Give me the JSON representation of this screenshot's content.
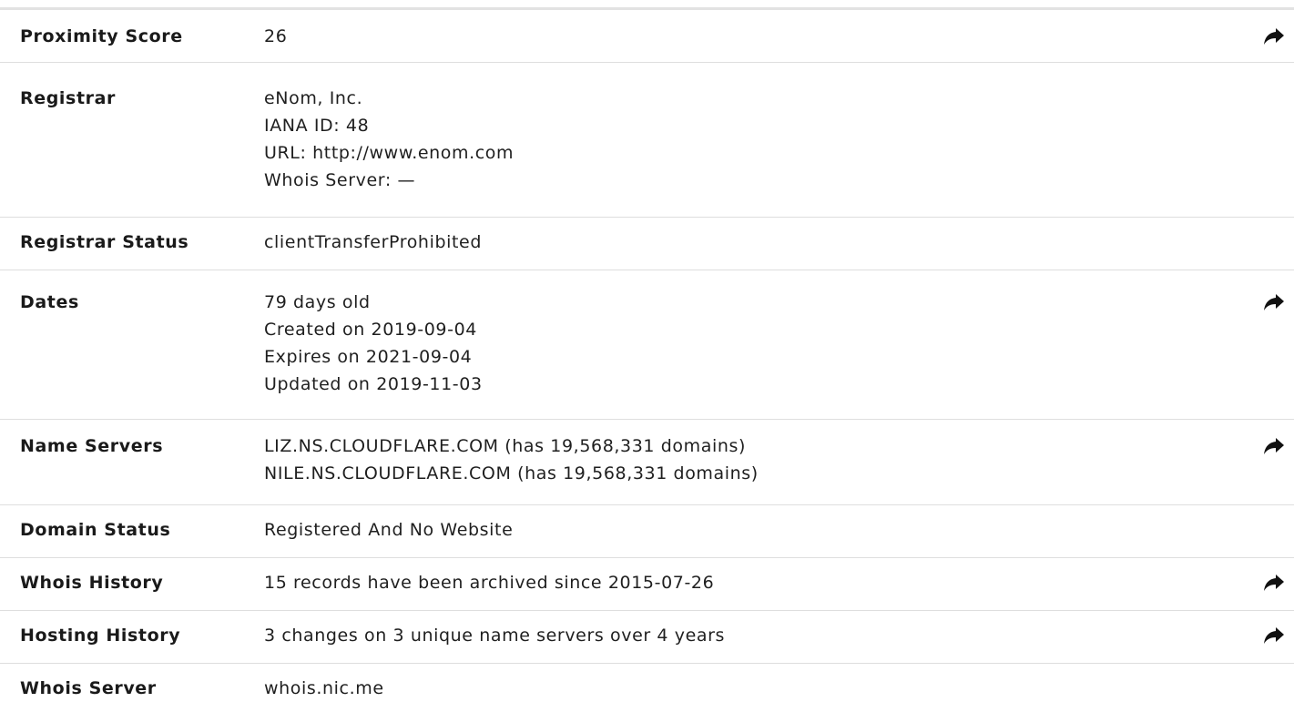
{
  "rows": [
    {
      "label": "Proximity Score",
      "lines": [
        "26"
      ],
      "share": true
    },
    {
      "label": "Registrar",
      "lines": [
        "eNom, Inc.",
        "IANA ID: 48",
        "URL: http://www.enom.com",
        "Whois Server: —"
      ],
      "share": false
    },
    {
      "label": "Registrar Status",
      "lines": [
        "clientTransferProhibited"
      ],
      "share": false
    },
    {
      "label": "Dates",
      "lines": [
        "79 days old",
        "Created on 2019-09-04",
        "Expires on 2021-09-04",
        "Updated on 2019-11-03"
      ],
      "share": true
    },
    {
      "label": "Name Servers",
      "lines": [
        "LIZ.NS.CLOUDFLARE.COM (has 19,568,331 domains)",
        "NILE.NS.CLOUDFLARE.COM (has 19,568,331 domains)"
      ],
      "share": true
    },
    {
      "label": "Domain Status",
      "lines": [
        "Registered And No Website"
      ],
      "share": false
    },
    {
      "label": "Whois History",
      "lines": [
        "15 records have been archived since 2015-07-26"
      ],
      "share": true
    },
    {
      "label": "Hosting History",
      "lines": [
        "3 changes on 3 unique name servers over 4 years"
      ],
      "share": true
    },
    {
      "label": "Whois Server",
      "lines": [
        "whois.nic.me"
      ],
      "share": false
    }
  ],
  "icons": {
    "share": "share-arrow-icon"
  },
  "colors": {
    "text": "#1c1c1c",
    "divider": "#dedede",
    "top_rule": "#e2e2e2"
  }
}
